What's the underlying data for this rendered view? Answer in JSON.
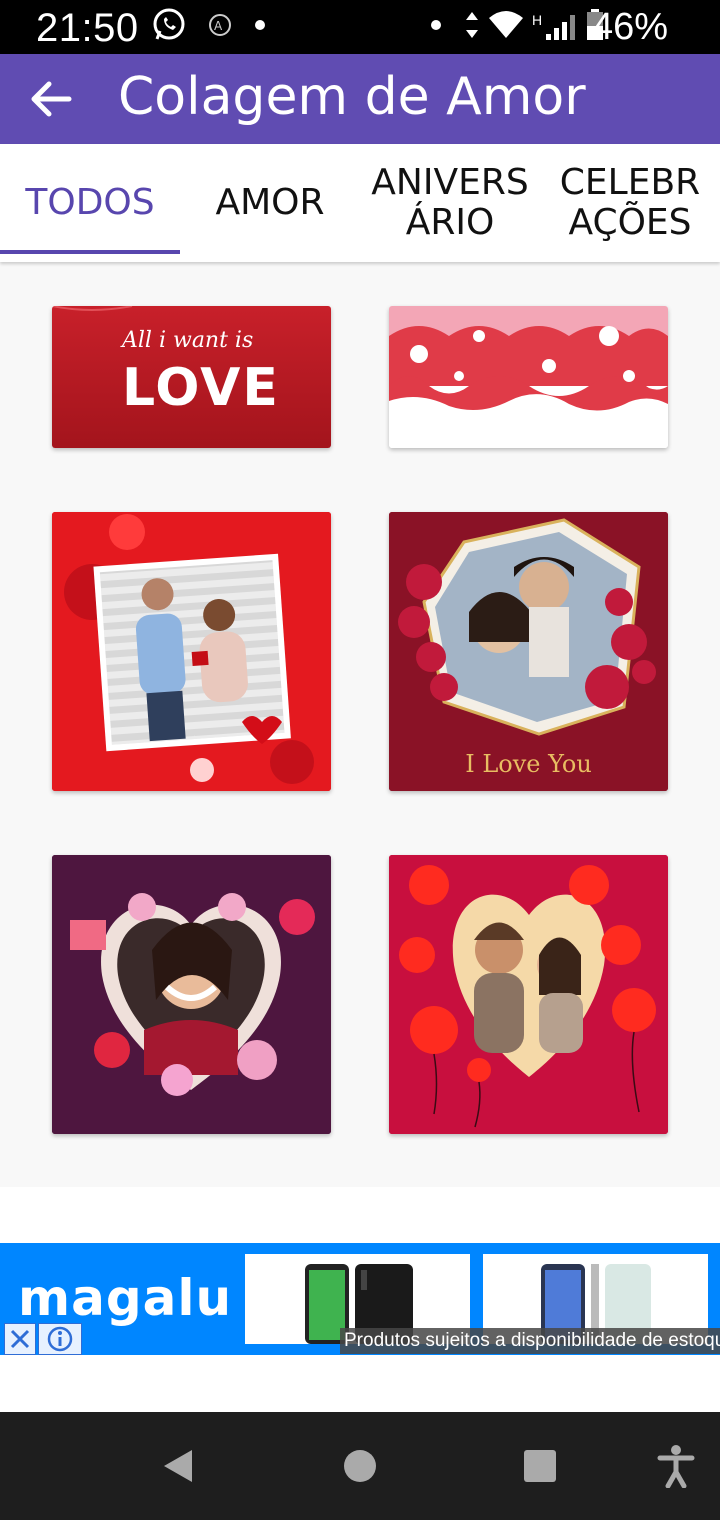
{
  "status_bar": {
    "time": "21:50",
    "battery": "46%",
    "network_type": "H",
    "icons": [
      "whatsapp-icon",
      "sync-icon",
      "dot-icon",
      "dot-icon",
      "data-arrows-icon",
      "wifi-icon",
      "signal-icon",
      "battery-icon"
    ]
  },
  "appbar": {
    "title": "Colagem de Amor",
    "color": "#604CB2"
  },
  "tabs": [
    {
      "line1": "TODOS",
      "line2": "",
      "active": true
    },
    {
      "line1": "AMOR",
      "line2": "",
      "active": false
    },
    {
      "line1": "ANIVERS",
      "line2": "ÁRIO",
      "active": false
    },
    {
      "line1": "CELEBR",
      "line2": "AÇÕES",
      "active": false
    }
  ],
  "accent_color": "#5846AE",
  "grid": {
    "cards": [
      {
        "name": "love-template-card",
        "caption": "All i want is",
        "big_text": "LOVE"
      },
      {
        "name": "hearts-clouds-template-card"
      },
      {
        "name": "proposal-frame-template-card"
      },
      {
        "name": "i-love-you-frame-template-card",
        "caption": "I Love You"
      },
      {
        "name": "cupid-heart-frame-template-card"
      },
      {
        "name": "balloons-heart-frame-template-card"
      }
    ]
  },
  "ad": {
    "brand": "magalu",
    "disclaimer": "Produtos sujeitos a disponibilidade de estoque",
    "background": "#0086FF"
  },
  "nav": {
    "buttons": [
      "back-nav-icon",
      "home-nav-icon",
      "recents-nav-icon",
      "accessibility-icon"
    ]
  }
}
